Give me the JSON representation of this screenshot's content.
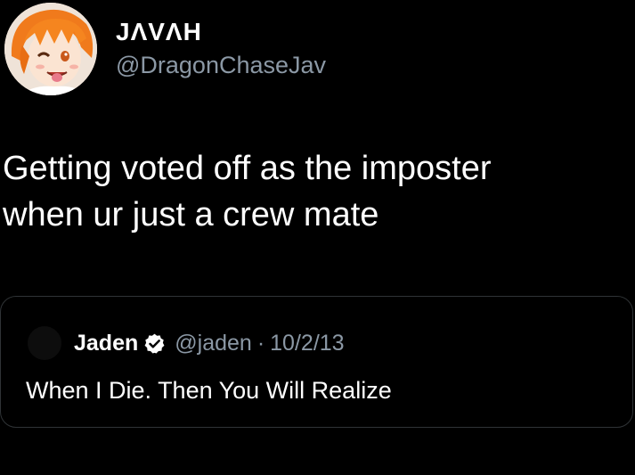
{
  "tweet": {
    "author": {
      "display_name": "JΛVΛH",
      "handle": "@DragonChaseJav",
      "avatar_icon": "anime-character-avatar"
    },
    "text_lines": [
      "Getting voted off as the imposter",
      "when ur just a crew mate"
    ]
  },
  "quoted_tweet": {
    "author": {
      "display_name": "Jaden",
      "handle": "@jaden",
      "verified_icon": "verified-badge-icon"
    },
    "separator": "·",
    "date": "10/2/13",
    "text": "When I Die. Then You Will Realize"
  },
  "colors": {
    "background": "#000000",
    "text_primary": "#ffffff",
    "text_secondary": "#8b98a5",
    "border": "#2f3336"
  }
}
